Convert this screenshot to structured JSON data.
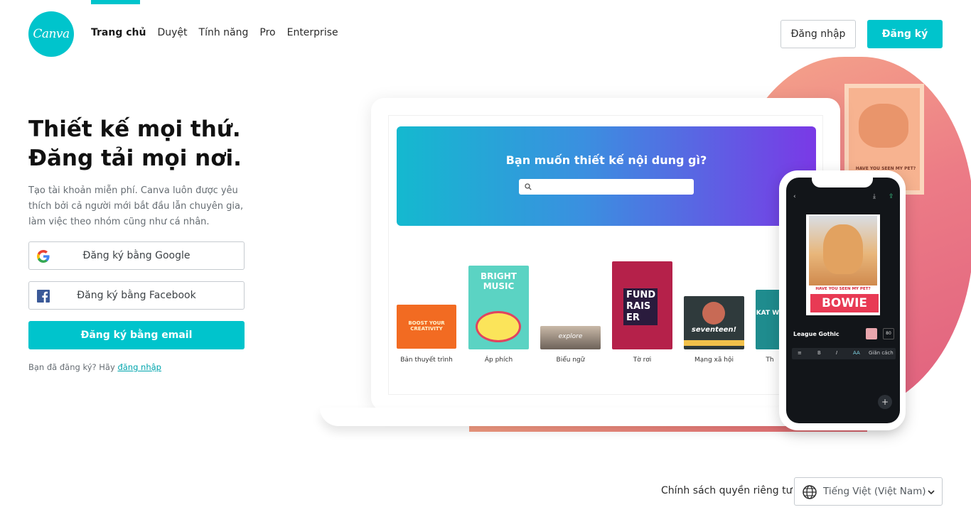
{
  "brand": {
    "logo_text": "Canva",
    "accent": "#00c4cc"
  },
  "nav": {
    "items": [
      {
        "label": "Trang chủ",
        "active": true
      },
      {
        "label": "Duyệt"
      },
      {
        "label": "Tính năng"
      },
      {
        "label": "Pro"
      },
      {
        "label": "Enterprise"
      }
    ]
  },
  "header": {
    "login_label": "Đăng nhập",
    "signup_label": "Đăng ký"
  },
  "hero": {
    "title_line1": "Thiết kế mọi thứ.",
    "title_line2": "Đăng tải mọi nơi.",
    "description": "Tạo tài khoản miễn phí. Canva luôn được yêu thích bởi cả người mới bắt đầu lẫn chuyên gia, làm việc theo nhóm cũng như cá nhân.",
    "google_label": "Đăng ký bằng Google",
    "facebook_label": "Đăng ký bằng Facebook",
    "email_label": "Đăng ký bằng email",
    "already_text": "Bạn đã đăng ký? Hãy ",
    "already_link": "đăng nhập"
  },
  "illustration": {
    "banner_title": "Bạn muốn thiết kế nội dung gì?",
    "templates": [
      {
        "label": "Bản thuyết trình",
        "art": "BOOST YOUR CREATIVITY"
      },
      {
        "label": "Áp phích",
        "art": "BRIGHT MUSIC"
      },
      {
        "label": "Biểu ngữ",
        "art": "explore"
      },
      {
        "label": "Tờ rơi",
        "art": "FUND RAIS ER"
      },
      {
        "label": "Mạng xã hội",
        "art": "seventeen!"
      },
      {
        "label": "Th",
        "art": "KAT WE"
      }
    ],
    "poster_text": "HAVE YOU SEEN MY PET?",
    "phone": {
      "small_text": "HAVE YOU SEEN MY PET?",
      "big_text": "BOWIE",
      "font_name": "League Gothic",
      "font_size": "80",
      "toolbar_spacing": "Giãn cách",
      "toolbar_aa": "AA",
      "toolbar_italic": "I",
      "toolbar_b": "B"
    }
  },
  "footer": {
    "privacy_label": "Chính sách quyền riêng tư",
    "language_label": "Tiếng Việt (Việt Nam)"
  }
}
